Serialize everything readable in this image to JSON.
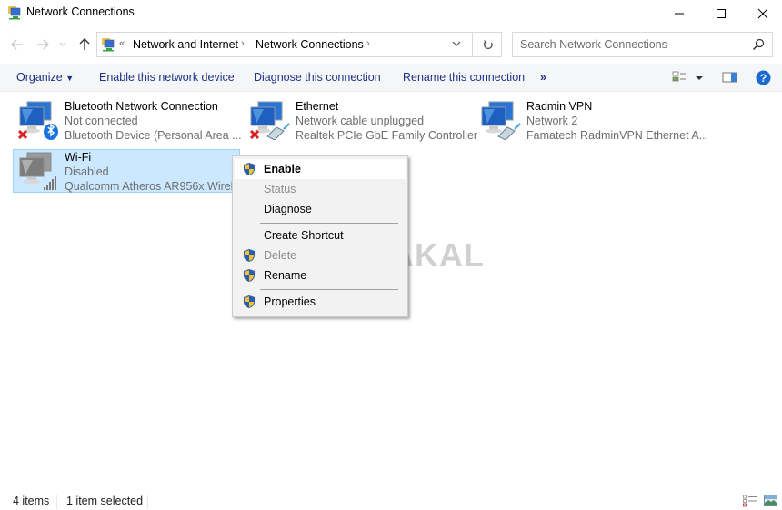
{
  "window": {
    "title": "Network Connections",
    "minimize_icon": "minimize-icon",
    "maximize_icon": "maximize-icon",
    "close_icon": "close-icon"
  },
  "navigation": {
    "back_icon": "arrow-left-icon",
    "forward_icon": "arrow-right-icon",
    "recent_icon": "chevron-down-icon",
    "up_icon": "arrow-up-icon",
    "overflow": "«",
    "breadcrumb": [
      "Network and Internet",
      "Network Connections"
    ],
    "refresh_icon": "refresh-icon"
  },
  "search": {
    "placeholder": "Search Network Connections",
    "icon": "search-icon"
  },
  "commandbar": {
    "organize": "Organize",
    "enable": "Enable this network device",
    "diagnose": "Diagnose this connection",
    "rename": "Rename this connection",
    "more": "»",
    "view_icon": "change-view-icon",
    "preview_icon": "preview-pane-icon",
    "help_icon": "help-icon"
  },
  "connections": [
    {
      "name": "Bluetooth Network Connection",
      "status": "Not connected",
      "device": "Bluetooth Device (Personal Area ...",
      "icon": "bluetooth-network-icon",
      "badge": "disconnected-x"
    },
    {
      "name": "Ethernet",
      "status": "Network cable unplugged",
      "device": "Realtek PCIe GbE Family Controller",
      "icon": "ethernet-network-icon",
      "badge": "disconnected-x"
    },
    {
      "name": "Radmin VPN",
      "status": "Network 2",
      "device": "Famatech RadminVPN Ethernet A...",
      "icon": "vpn-network-icon",
      "badge": ""
    },
    {
      "name": "Wi-Fi",
      "status": "Disabled",
      "device": "Qualcomm Atheros AR956x Wirel...",
      "icon": "wifi-network-icon",
      "badge": "signal-bars",
      "selected": true
    }
  ],
  "context_menu": {
    "items": [
      {
        "label": "Enable",
        "shield": true,
        "bold": true,
        "disabled": false
      },
      {
        "label": "Status",
        "shield": false,
        "bold": false,
        "disabled": true
      },
      {
        "label": "Diagnose",
        "shield": false,
        "bold": false,
        "disabled": false
      },
      {
        "label": "Create Shortcut",
        "shield": false,
        "bold": false,
        "disabled": false
      },
      {
        "label": "Delete",
        "shield": true,
        "bold": false,
        "disabled": true
      },
      {
        "label": "Rename",
        "shield": true,
        "bold": false,
        "disabled": false
      },
      {
        "label": "Properties",
        "shield": true,
        "bold": false,
        "disabled": false
      }
    ]
  },
  "watermark": "BERAKAL",
  "statusbar": {
    "item_count": "4 items",
    "selection": "1 item selected",
    "details_view_icon": "details-view-icon",
    "large_icons_view_icon": "large-icons-view-icon"
  }
}
